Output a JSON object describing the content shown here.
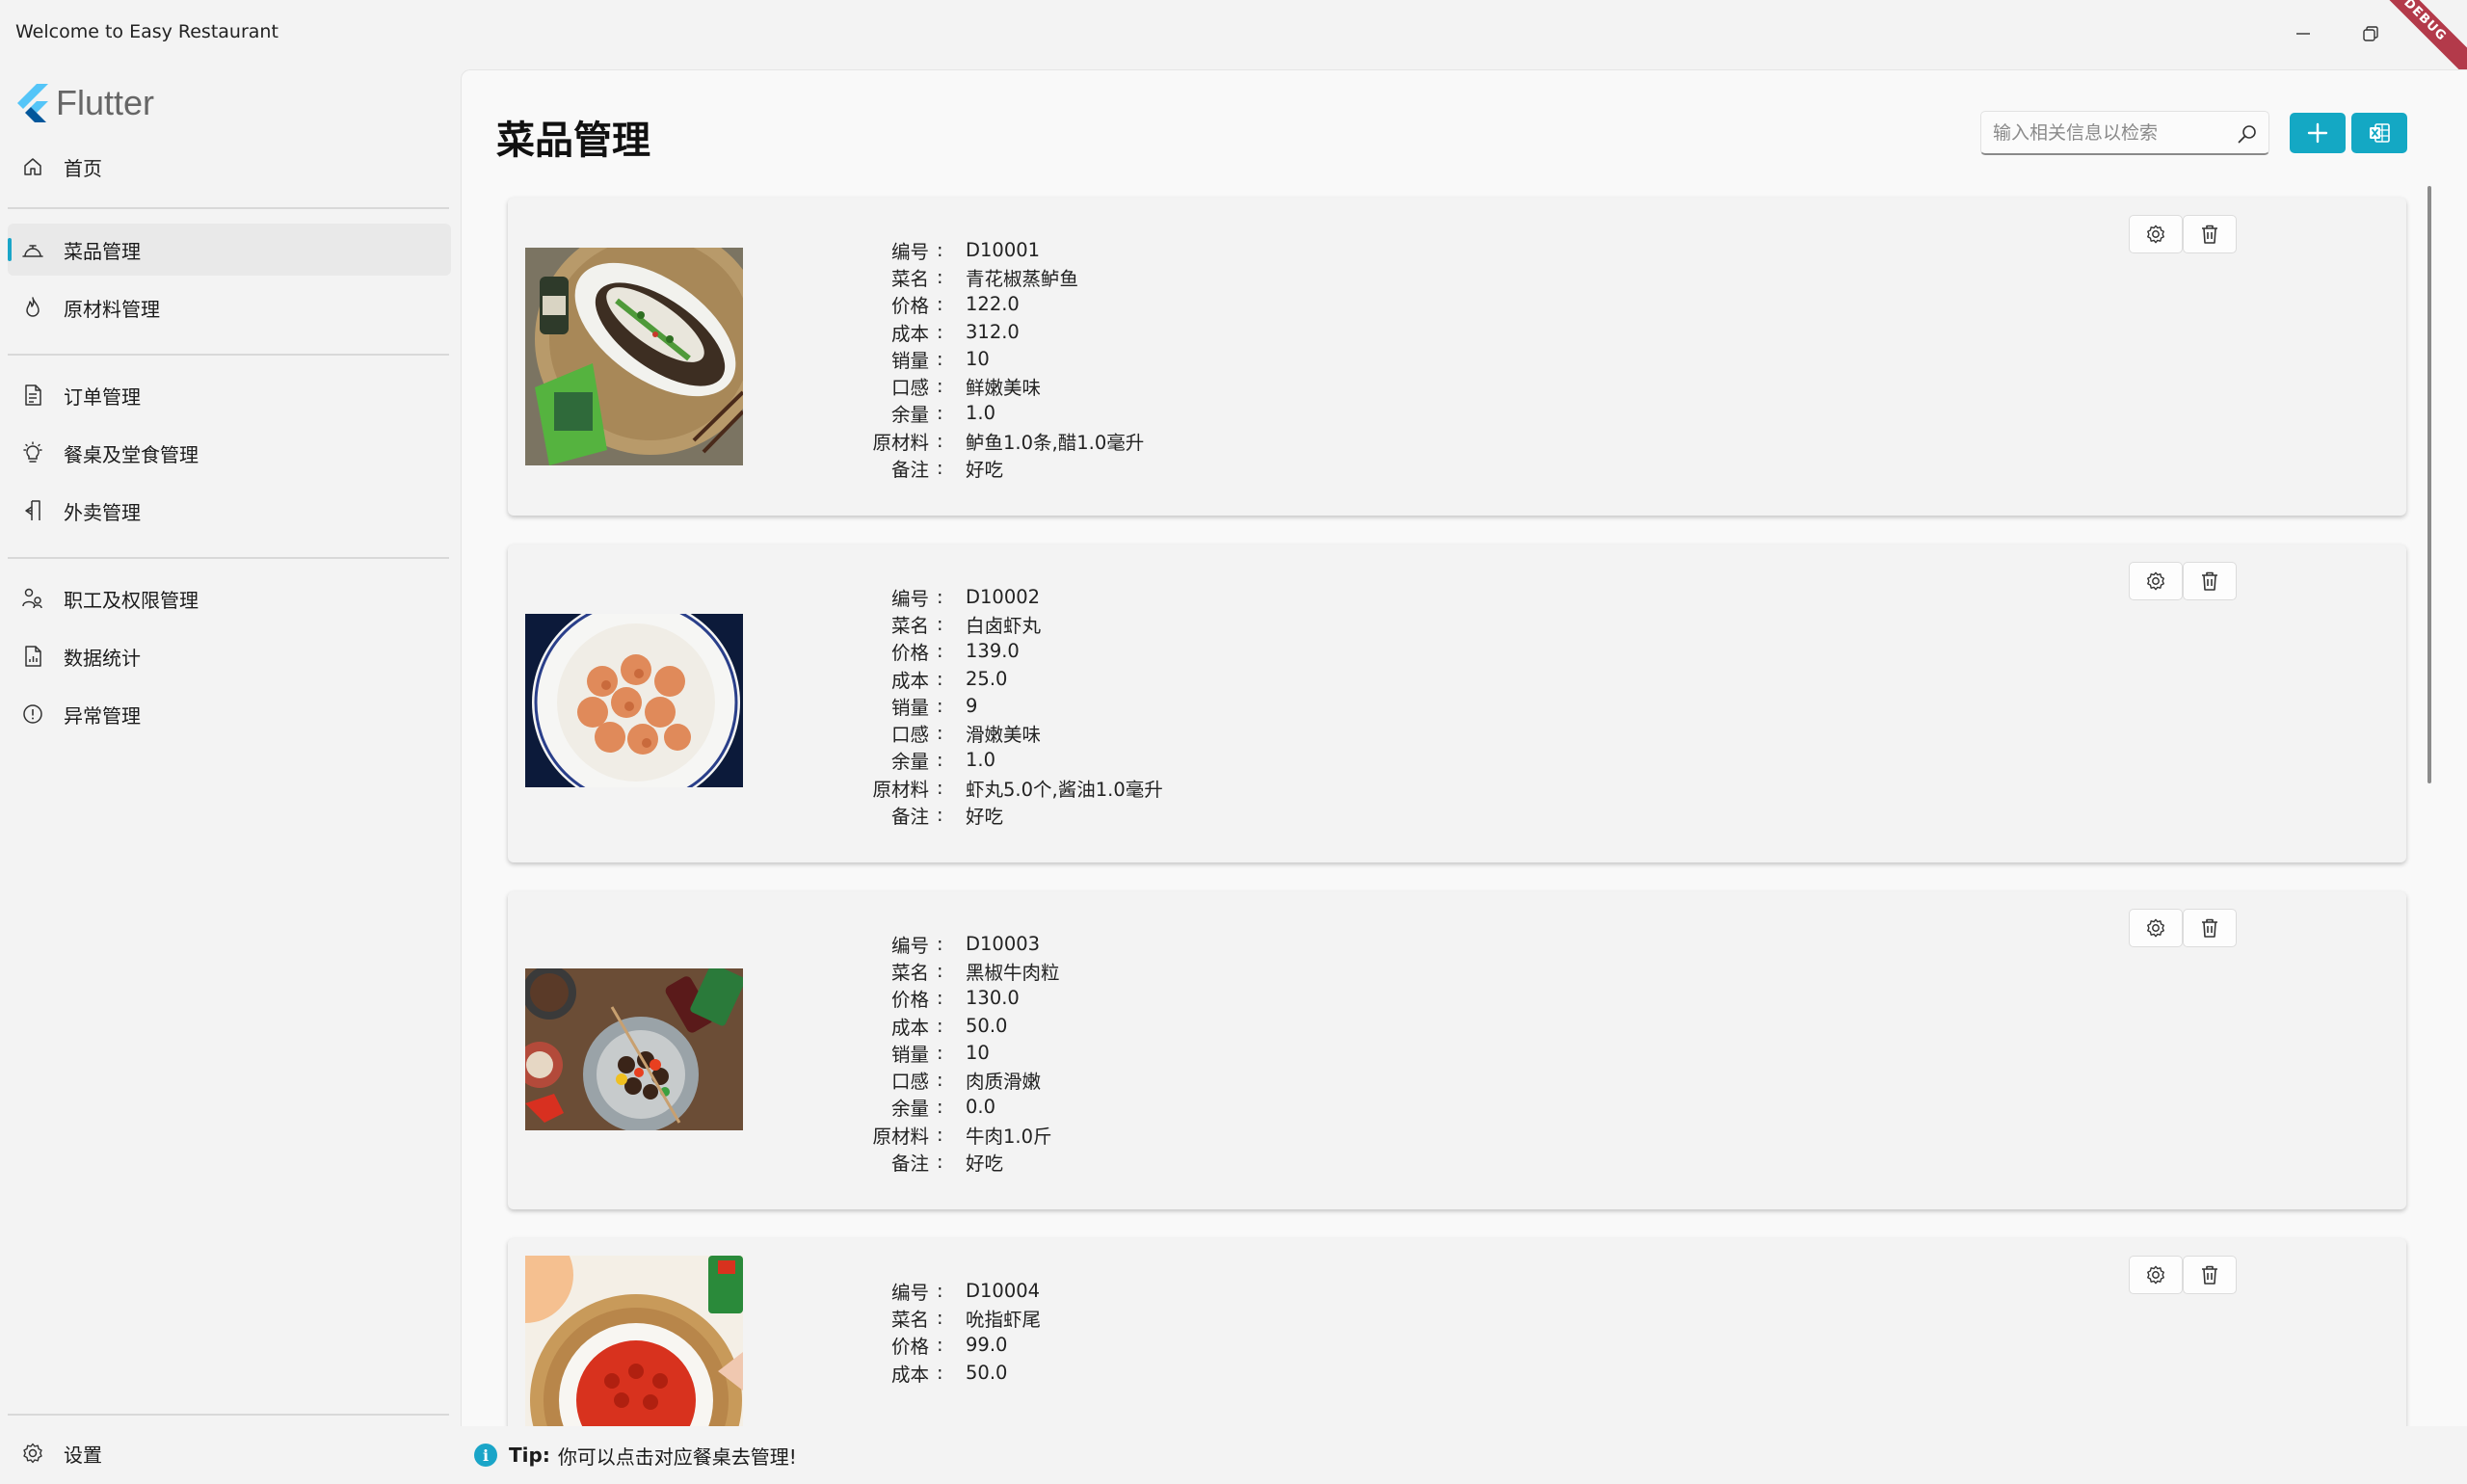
{
  "window": {
    "title": "Welcome to Easy Restaurant",
    "debug_badge": "DEBUG"
  },
  "sidebar": {
    "logo": "Flutter",
    "items": [
      {
        "label": "首页",
        "icon": "home-icon"
      },
      {
        "label": "菜品管理",
        "icon": "dish-icon",
        "active": true
      },
      {
        "label": "原材料管理",
        "icon": "fire-icon"
      },
      {
        "label": "订单管理",
        "icon": "document-icon"
      },
      {
        "label": "餐桌及堂食管理",
        "icon": "lightbulb-icon"
      },
      {
        "label": "外卖管理",
        "icon": "door-icon"
      },
      {
        "label": "职工及权限管理",
        "icon": "people-icon"
      },
      {
        "label": "数据统计",
        "icon": "chart-document-icon"
      },
      {
        "label": "异常管理",
        "icon": "alert-icon"
      }
    ],
    "settings_label": "设置"
  },
  "main": {
    "title": "菜品管理",
    "search_placeholder": "输入相关信息以检索"
  },
  "field_labels": {
    "id": "编号",
    "name": "菜名",
    "price": "价格",
    "cost": "成本",
    "sales": "销量",
    "taste": "口感",
    "stock": "余量",
    "materials": "原材料",
    "note": "备注"
  },
  "dishes": [
    {
      "id": "D10001",
      "name": "青花椒蒸鲈鱼",
      "price": "122.0",
      "cost": "312.0",
      "sales": "10",
      "taste": "鲜嫩美味",
      "stock": "1.0",
      "materials": "鲈鱼1.0条,醋1.0毫升",
      "note": "好吃"
    },
    {
      "id": "D10002",
      "name": "白卤虾丸",
      "price": "139.0",
      "cost": "25.0",
      "sales": "9",
      "taste": "滑嫩美味",
      "stock": "1.0",
      "materials": "虾丸5.0个,酱油1.0毫升",
      "note": "好吃"
    },
    {
      "id": "D10003",
      "name": "黑椒牛肉粒",
      "price": "130.0",
      "cost": "50.0",
      "sales": "10",
      "taste": "肉质滑嫩",
      "stock": "0.0",
      "materials": "牛肉1.0斤",
      "note": "好吃"
    },
    {
      "id": "D10004",
      "name": "吮指虾尾",
      "price": "99.0",
      "cost": "50.0"
    }
  ],
  "tip": {
    "label": "Tip:",
    "text": "你可以点击对应餐桌去管理!"
  },
  "colors": {
    "accent": "#14a8c4",
    "active_indicator": "#1aa5c8",
    "debug": "#b33a4a"
  }
}
